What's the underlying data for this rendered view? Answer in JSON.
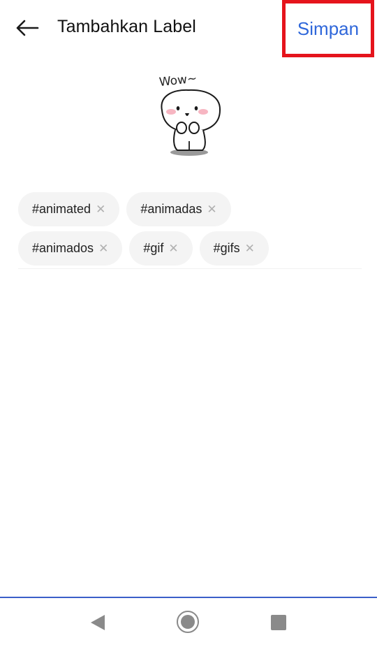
{
  "header": {
    "back_icon": "arrow-left-icon",
    "title": "Tambahkan Label",
    "save_label": "Simpan",
    "save_color": "#2f67da",
    "highlight_color": "#e5141c"
  },
  "sticker": {
    "caption": "Wow~",
    "icon": "cute-character-sticker"
  },
  "tags": [
    {
      "label": "#animated",
      "remove": "✕"
    },
    {
      "label": "#animadas",
      "remove": "✕"
    },
    {
      "label": "#animados",
      "remove": "✕"
    },
    {
      "label": "#gif",
      "remove": "✕"
    },
    {
      "label": "#gifs",
      "remove": "✕"
    }
  ],
  "navbar": {
    "back": "triangle-back-icon",
    "home": "circle-home-icon",
    "recents": "square-recents-icon",
    "accent": "#3b5fc9"
  }
}
